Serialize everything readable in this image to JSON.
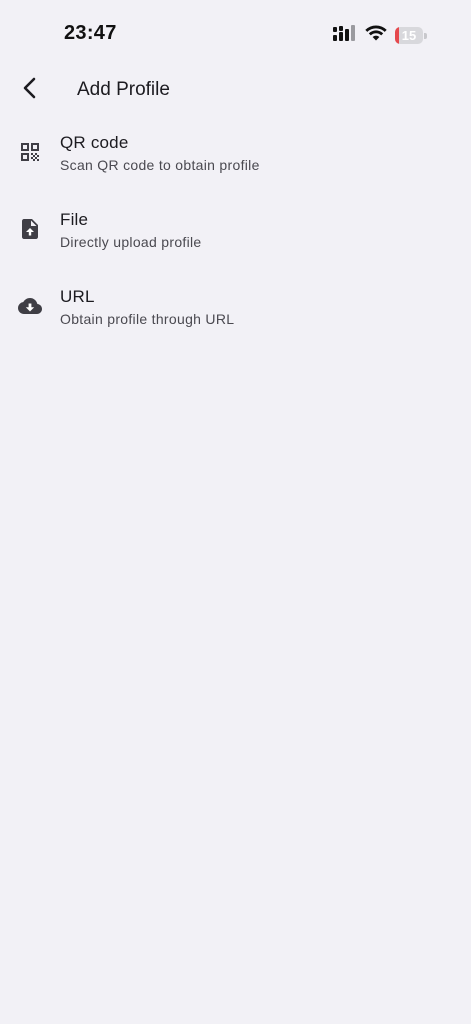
{
  "status_bar": {
    "time": "23:47",
    "battery_level": "15",
    "battery_fraction": 0.15,
    "battery_color": "#E5484D",
    "icons": [
      "cellular-signal-icon",
      "wifi-icon",
      "battery-icon"
    ]
  },
  "header": {
    "back_icon": "chevron-left-icon",
    "title": "Add Profile"
  },
  "options": [
    {
      "icon": "qr-code-icon",
      "title": "QR code",
      "subtitle": "Scan QR code to obtain profile"
    },
    {
      "icon": "file-upload-icon",
      "title": "File",
      "subtitle": "Directly upload profile"
    },
    {
      "icon": "cloud-download-icon",
      "title": "URL",
      "subtitle": "Obtain profile through URL"
    }
  ],
  "colors": {
    "background": "#F2F1F6",
    "icon": "#3F3E45",
    "text_primary": "#1C1B20",
    "text_secondary": "#4A4950"
  }
}
